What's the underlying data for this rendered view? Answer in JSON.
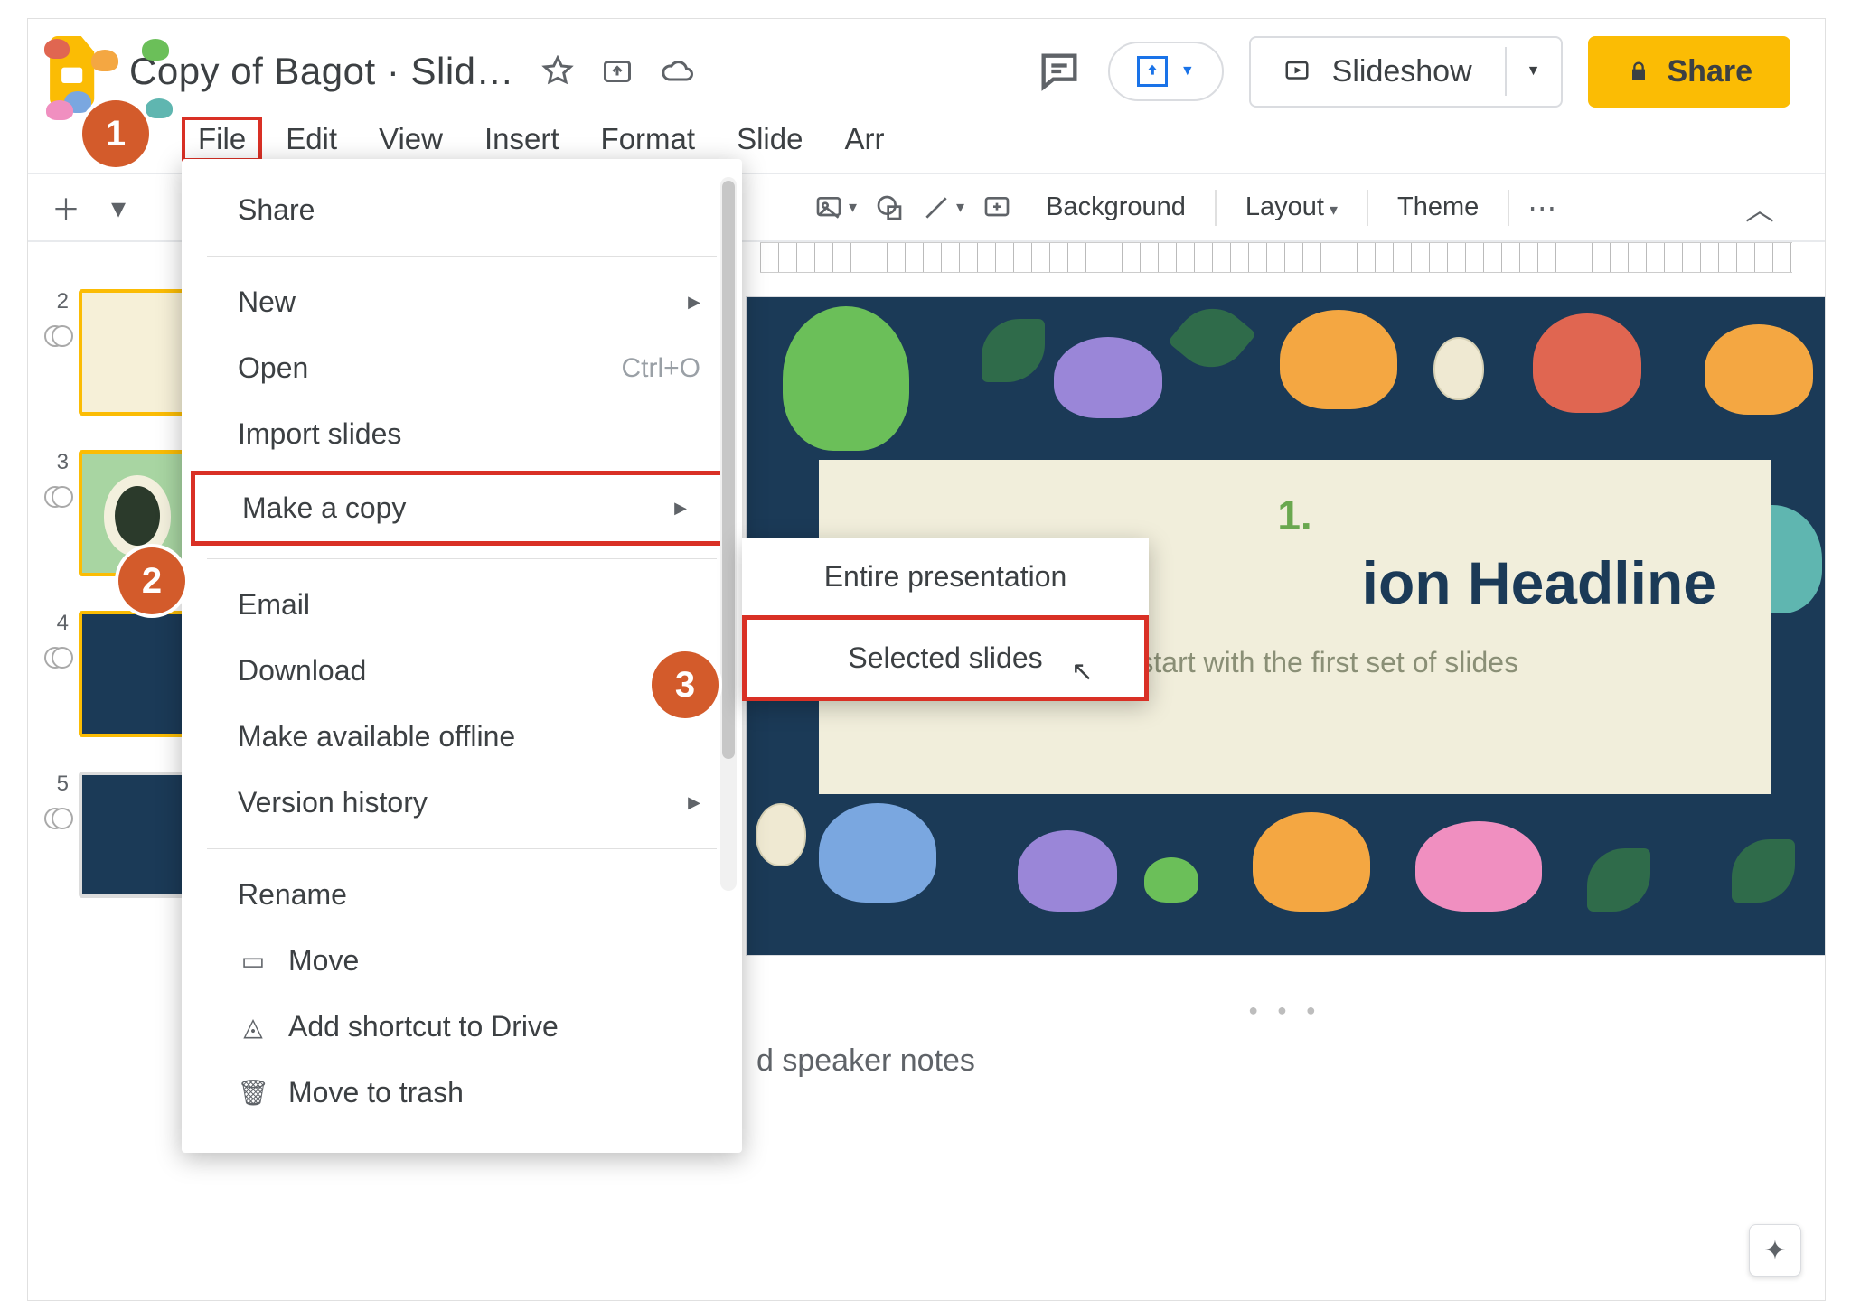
{
  "header": {
    "doc_title": "Copy of Bagot · Slid…",
    "slideshow_label": "Slideshow",
    "share_label": "Share"
  },
  "menubar": {
    "file": "File",
    "edit": "Edit",
    "view": "View",
    "insert": "Insert",
    "format": "Format",
    "slide": "Slide",
    "arrange_truncated": "Arr"
  },
  "toolbar": {
    "background": "Background",
    "layout": "Layout",
    "theme": "Theme"
  },
  "file_menu": {
    "share": "Share",
    "new": "New",
    "open": "Open",
    "open_shortcut": "Ctrl+O",
    "import_slides": "Import slides",
    "make_a_copy": "Make a copy",
    "email": "Email",
    "download": "Download",
    "make_available_offline": "Make available offline",
    "version_history": "Version history",
    "rename": "Rename",
    "move": "Move",
    "add_shortcut": "Add shortcut to Drive",
    "move_to_trash": "Move to trash"
  },
  "submenu": {
    "entire_presentation": "Entire presentation",
    "selected_slides": "Selected slides"
  },
  "filmstrip": {
    "slides": [
      "2",
      "3",
      "4",
      "5"
    ]
  },
  "canvas": {
    "section_number": "1.",
    "headline_visible": "ion Headline",
    "subtitle": "Let's start with the first set of slides"
  },
  "speaker_notes_visible": "d speaker notes",
  "annotations": {
    "step1": "1",
    "step2": "2",
    "step3": "3"
  }
}
